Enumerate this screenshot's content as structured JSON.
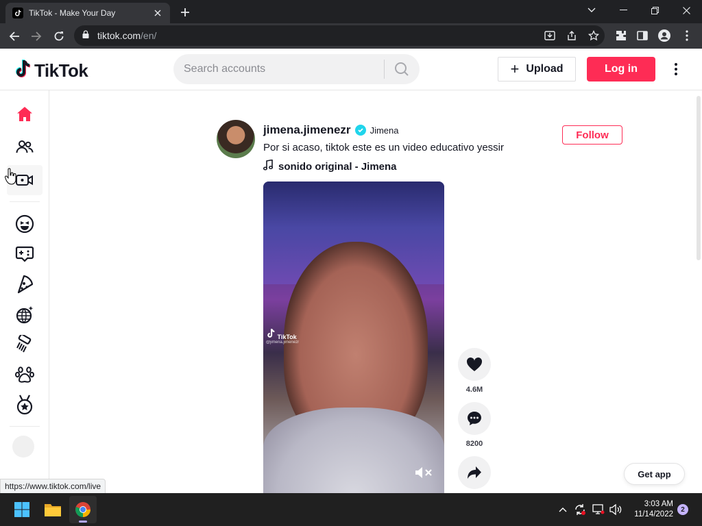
{
  "browser": {
    "tab_title": "TikTok - Make Your Day",
    "url_host": "tiktok.com",
    "url_path": "/en/",
    "status_url": "https://www.tiktok.com/live"
  },
  "header": {
    "logo_text": "TikTok",
    "search_placeholder": "Search accounts",
    "upload_label": "Upload",
    "login_label": "Log in"
  },
  "sidebar": {
    "items": [
      "home-icon",
      "following-icon",
      "live-icon",
      "comedy-icon",
      "gaming-icon",
      "food-icon",
      "dance-icon",
      "beauty-icon",
      "animals-icon",
      "sports-icon"
    ]
  },
  "post": {
    "username": "jimena.jimenezr",
    "nickname": "Jimena",
    "caption": "Por si acaso, tiktok este es un video educativo yessir",
    "music": "sonido original - Jimena",
    "follow_label": "Follow",
    "watermark_brand": "TikTok",
    "watermark_handle": "@jimena.jimenezr",
    "likes": "4.6M",
    "comments": "8200"
  },
  "get_app_label": "Get app",
  "taskbar": {
    "time": "3:03 AM",
    "date": "11/14/2022",
    "notifications": "2"
  },
  "colors": {
    "brand": "#fe2c55",
    "verified": "#20d5ec",
    "chrome_dark": "#202124"
  }
}
